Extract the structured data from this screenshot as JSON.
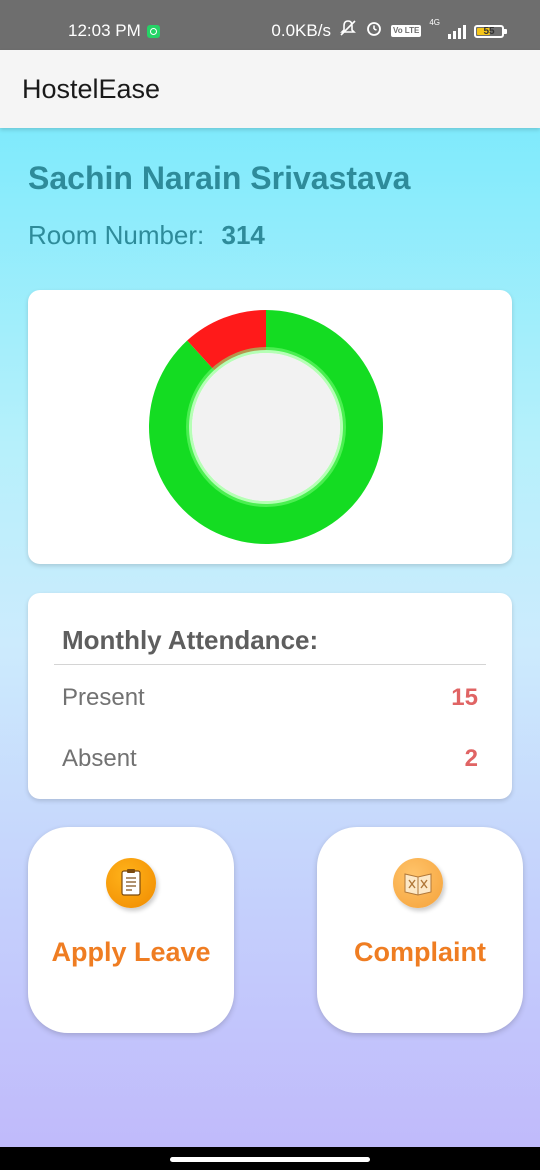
{
  "status_bar": {
    "time": "12:03 PM",
    "network_speed": "0.0KB/s",
    "network_type": "4G",
    "volte": "Vo LTE",
    "battery": "55",
    "icons": [
      "whatsapp-icon",
      "mute-icon",
      "alarm-icon",
      "volte-icon",
      "signal-icon",
      "battery-icon"
    ]
  },
  "app_bar": {
    "title": "HostelEase"
  },
  "student": {
    "name": "Sachin Narain Srivastava",
    "room_label": "Room Number:",
    "room_number": "314"
  },
  "chart_data": {
    "type": "pie",
    "variant": "donut",
    "slices": [
      {
        "label": "Present",
        "value": 15,
        "color": "#14dc22"
      },
      {
        "label": "Absent",
        "value": 2,
        "color": "#ff1a1a"
      }
    ],
    "title": "",
    "legend": "none"
  },
  "attendance": {
    "title": "Monthly Attendance:",
    "rows": [
      {
        "label": "Present",
        "value": "15"
      },
      {
        "label": "Absent",
        "value": "2"
      }
    ]
  },
  "actions": {
    "apply_leave": {
      "label": "Apply Leave",
      "icon": "clipboard-icon"
    },
    "complaint": {
      "label": "Complaint",
      "icon": "complaint-book-icon"
    }
  },
  "colors": {
    "accent_teal": "#2e8b9a",
    "action_orange": "#ef7d22",
    "value_red": "#e06464"
  }
}
